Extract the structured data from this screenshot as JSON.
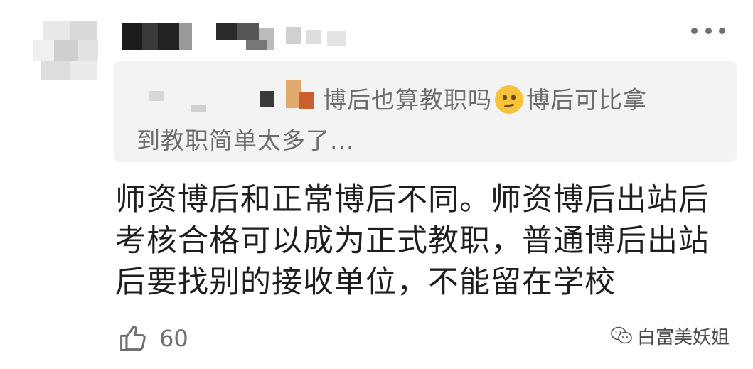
{
  "quote": {
    "text_line1": "博后也算教职吗",
    "emoji": "thinking-face-icon",
    "text_line1_end": "博后可比拿",
    "text_line2": "到教职简单太多了..."
  },
  "comment": {
    "text": "师资博后和正常博后不同。师资博后出站后考核合格可以成为正式教职，普通博后出站后要找别的接收单位，不能留在学校"
  },
  "like": {
    "icon": "thumbs-up-icon",
    "count": "60"
  },
  "watermark": {
    "icon": "wechat-icon",
    "text": "白富美妖姐"
  },
  "colors": {
    "quote_bg": "#f3f3f3",
    "quote_text": "#6c6c6c",
    "comment_text": "#1e1e1e",
    "meta_text": "#707070"
  }
}
